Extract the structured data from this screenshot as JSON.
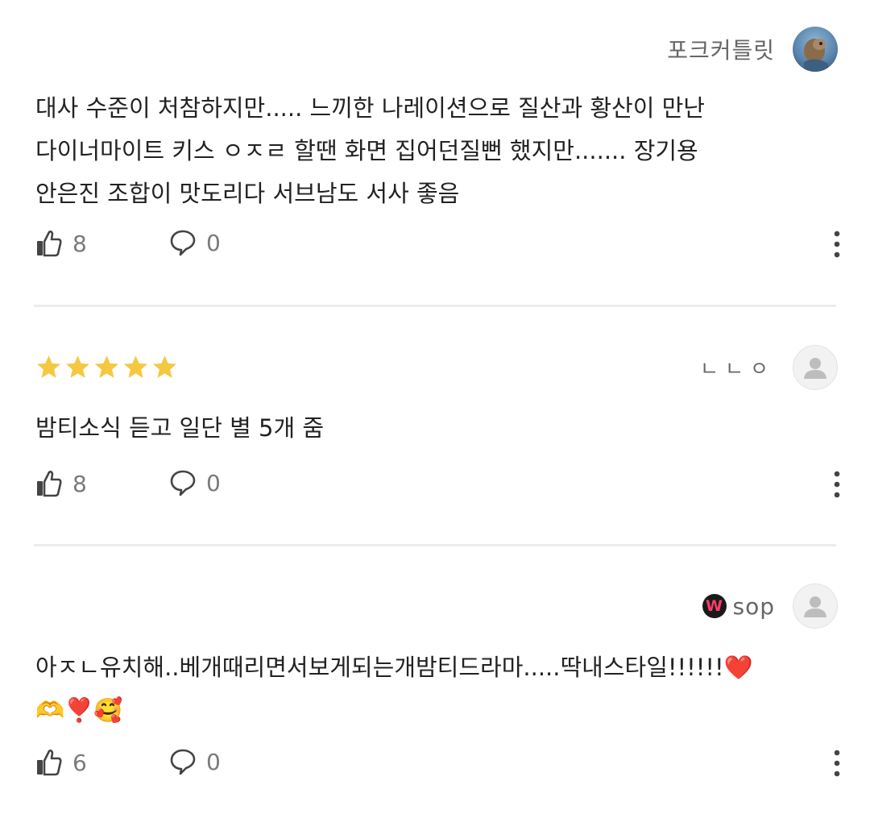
{
  "comments": [
    {
      "author": "포크커틀릿",
      "text": "대사 수준이 처참하지만..... 느끼한 나레이션으로 질산과 황산이 만난\n다이너마이트 키스 ㅇㅈㄹ 할땐 화면 집어던질뻔 했지만....... 장기용\n안은진 조합이 맛도리다 서브남도 서사 좋음",
      "likes": "8",
      "replies": "0",
      "avatar_icon": "photo-avatar"
    },
    {
      "author": "ㄴㄴㅇ",
      "rating": 5,
      "star_color": "#f5c842",
      "text": "밤티소식 듣고 일단 별 5개 줌",
      "likes": "8",
      "replies": "0",
      "avatar_icon": "default-user-icon"
    },
    {
      "author": "sop",
      "author_badge": "W",
      "text": "아ㅈㄴ유치해..베개때리면서보게되는개밤티드라마.....딱내스타일!!!!!!❤️\n🫶❣️🥰",
      "likes": "6",
      "replies": "0",
      "avatar_icon": "default-user-icon"
    }
  ]
}
